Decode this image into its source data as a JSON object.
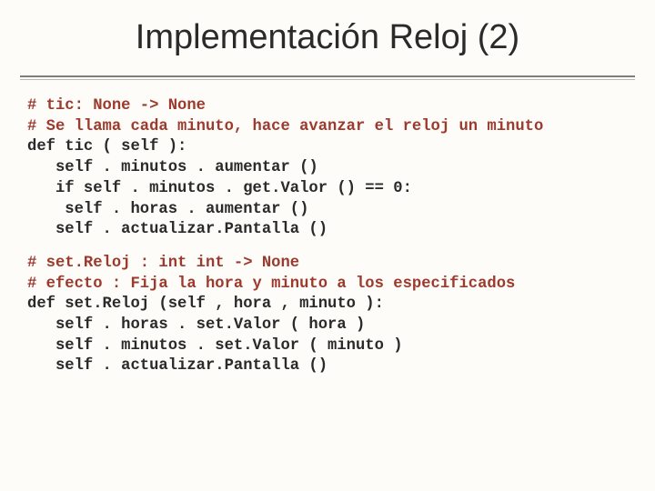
{
  "title": "Implementación Reloj (2)",
  "code": {
    "block1": {
      "c1": "# tic: None -> None",
      "c2": "# Se llama cada minuto, hace avanzar el reloj un minuto",
      "l1": "def tic ( self ):",
      "l2": "   self . minutos . aumentar ()",
      "l3": "   if self . minutos . get.Valor () == 0:",
      "l4": "    self . horas . aumentar ()",
      "l5": "   self . actualizar.Pantalla ()"
    },
    "block2": {
      "c1": "# set.Reloj : int int -> None",
      "c2": "# efecto : Fija la hora y minuto a los especificados",
      "l1": "def set.Reloj (self , hora , minuto ):",
      "l2": "   self . horas . set.Valor ( hora )",
      "l3": "   self . minutos . set.Valor ( minuto )",
      "l4": "   self . actualizar.Pantalla ()"
    }
  }
}
